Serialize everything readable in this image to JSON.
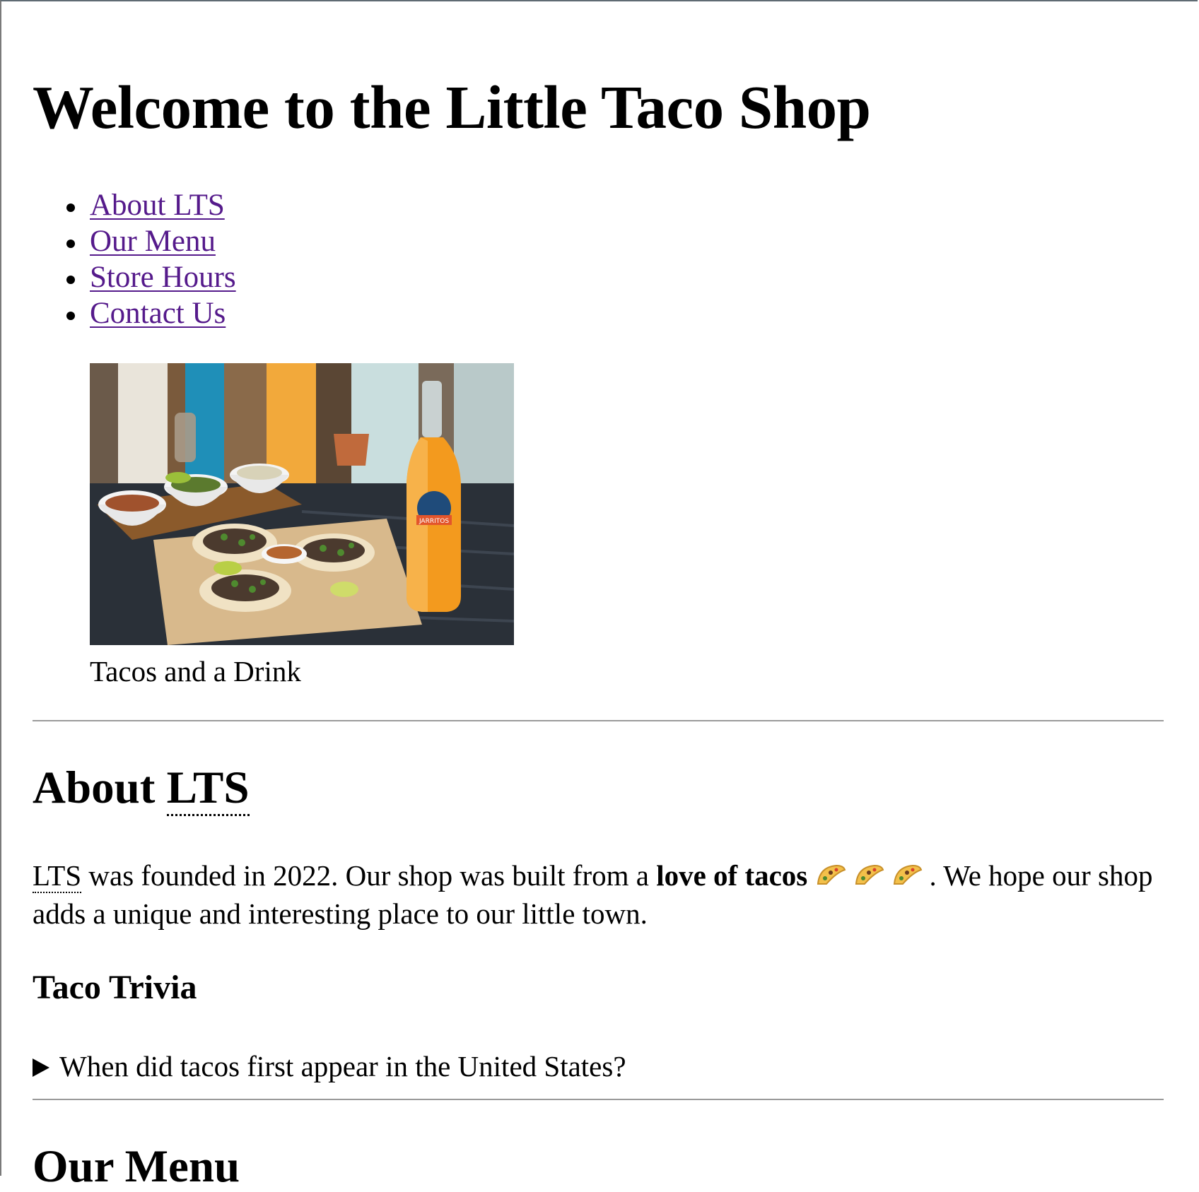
{
  "page": {
    "title": "Welcome to the Little Taco Shop"
  },
  "nav": {
    "items": [
      {
        "label": "About LTS"
      },
      {
        "label": "Our Menu"
      },
      {
        "label": "Store Hours"
      },
      {
        "label": "Contact Us"
      }
    ]
  },
  "hero": {
    "caption": "Tacos and a Drink",
    "bottle_label": "JARRITOS"
  },
  "about": {
    "heading_word": "About",
    "heading_abbr": "LTS",
    "abbr_title": "Little Taco Shop",
    "text_abbr": "LTS",
    "text_part1": " was founded in 2022. Our shop was built from a ",
    "text_bold": "love of tacos",
    "text_part2": ". We hope our shop adds a unique and interesting place to our little town.",
    "emoji_icon": "taco-emoji-icon"
  },
  "trivia": {
    "heading": "Taco Trivia",
    "question": "When did tacos first appear in the United States?",
    "toggle_icon": "disclosure-triangle-icon"
  },
  "menu": {
    "heading": "Our Menu"
  },
  "colors": {
    "link_visited": "#551a8b",
    "rule": "#9a9a9a"
  }
}
